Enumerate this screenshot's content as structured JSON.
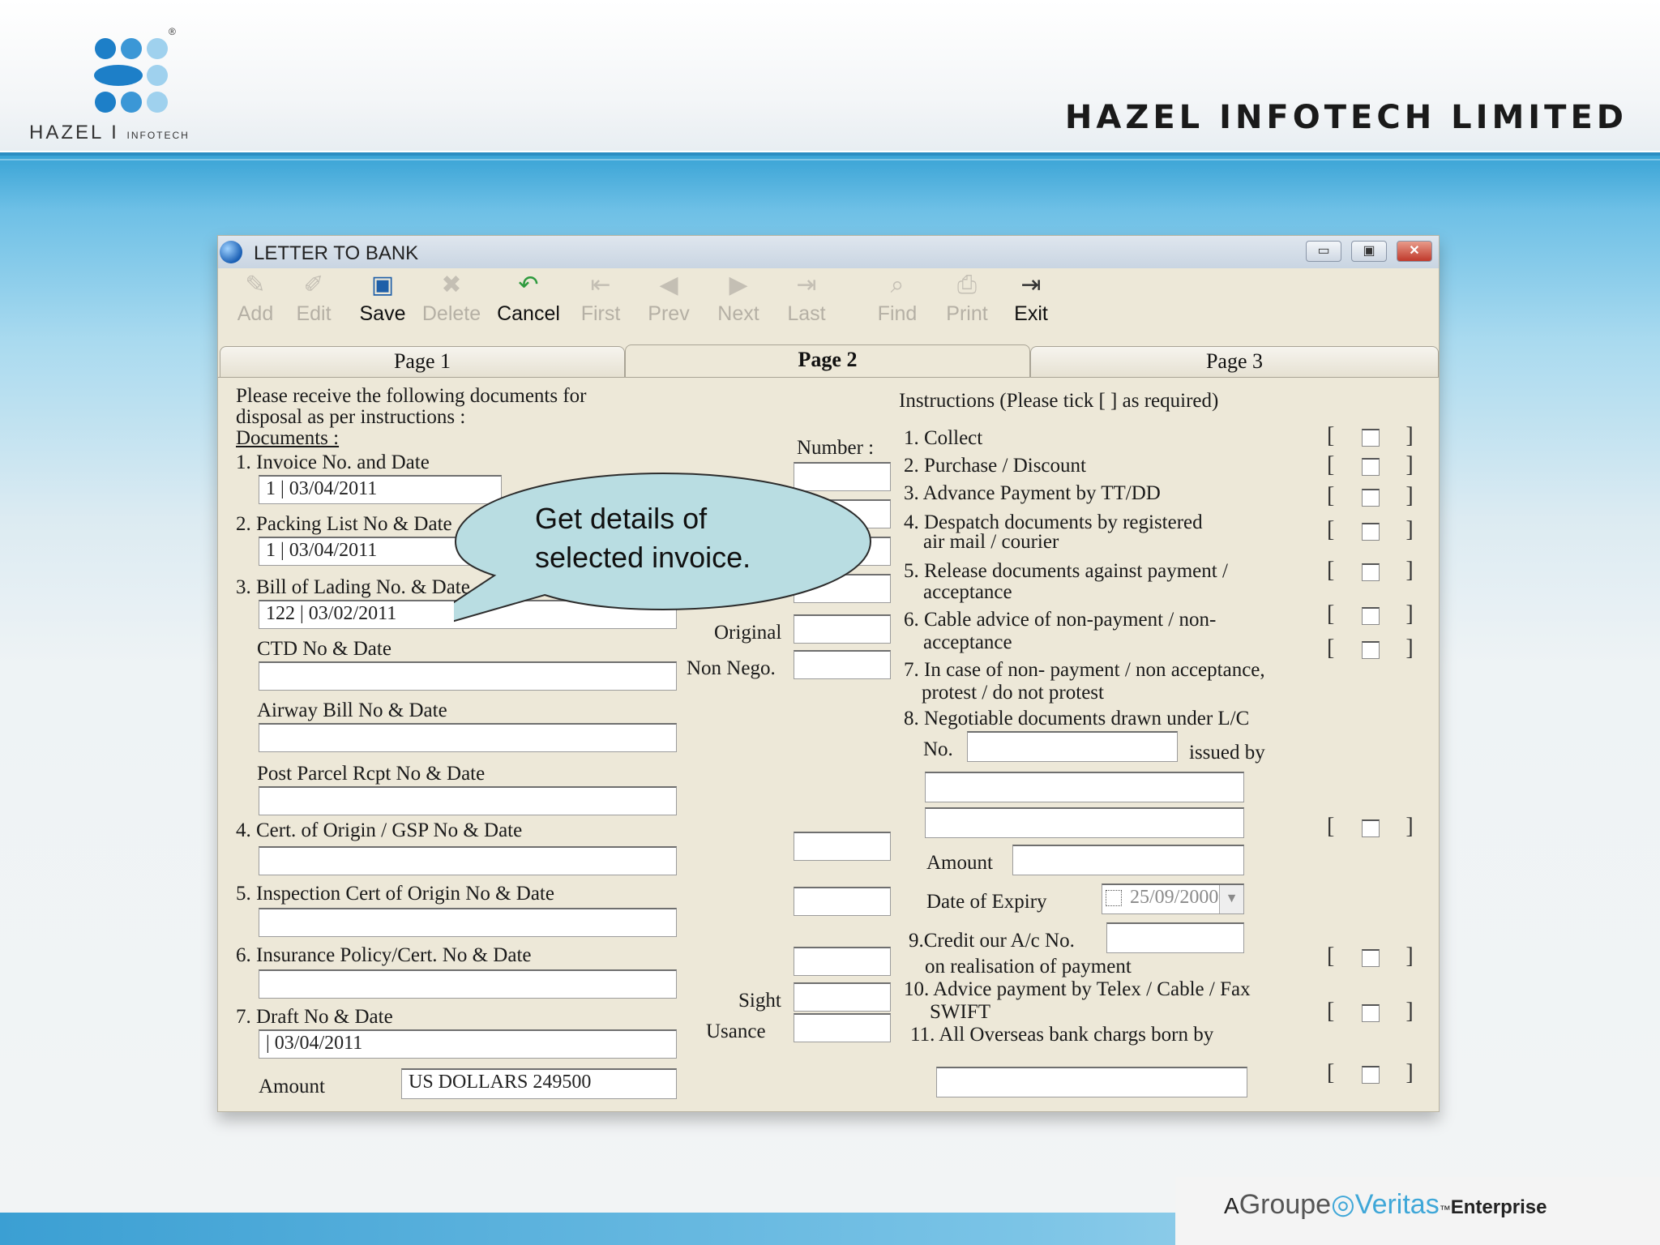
{
  "header": {
    "logo_text": "HAZEL",
    "logo_sub": "INFOTECH",
    "logo_sep": "I",
    "registered": "®",
    "company": "HAZEL INFOTECH LIMITED"
  },
  "footer": {
    "a": "A",
    "groupe": "Groupe",
    "veritas": "Veritas",
    "tm": "™",
    "enterprise": "Enterprise"
  },
  "window": {
    "title": "LETTER TO BANK",
    "controls": {
      "minimize": "▭",
      "maximize": "▣",
      "close": "✕"
    }
  },
  "toolbar": [
    {
      "label": "Add",
      "icon": "add-icon",
      "enabled": false
    },
    {
      "label": "Edit",
      "icon": "edit-icon",
      "enabled": false
    },
    {
      "label": "Save",
      "icon": "save-icon",
      "enabled": true
    },
    {
      "label": "Delete",
      "icon": "delete-icon",
      "enabled": false
    },
    {
      "label": "Cancel",
      "icon": "cancel-icon",
      "enabled": true
    },
    {
      "label": "First",
      "icon": "first-icon",
      "enabled": false
    },
    {
      "label": "Prev",
      "icon": "prev-icon",
      "enabled": false
    },
    {
      "label": "Next",
      "icon": "next-icon",
      "enabled": false
    },
    {
      "label": "Last",
      "icon": "last-icon",
      "enabled": false
    },
    {
      "label": "Find",
      "icon": "find-icon",
      "enabled": false
    },
    {
      "label": "Print",
      "icon": "print-icon",
      "enabled": false
    },
    {
      "label": "Exit",
      "icon": "exit-icon",
      "enabled": true
    }
  ],
  "tabs": [
    {
      "label": "Page 1",
      "active": false
    },
    {
      "label": "Page 2",
      "active": true
    },
    {
      "label": "Page 3",
      "active": false
    }
  ],
  "left": {
    "intro_line1": "Please receive the following documents for",
    "intro_line2": "disposal as per instructions  :",
    "documents_label": "Documents :",
    "number_label": "Number :",
    "invoice_label": "1. Invoice No. and Date",
    "invoice_value": "1  |  03/04/2011",
    "packing_label": "2. Packing List No & Date",
    "packing_value": "1  |  03/04/2011",
    "bol_label": "3. Bill of Lading No. & Date",
    "bol_value": "122 | 03/02/2011",
    "ctd_label": "CTD No & Date",
    "airway_label": "Airway Bill No & Date",
    "parcel_label": "Post Parcel Rcpt No & Date",
    "origin_label": "4. Cert. of Origin / GSP No & Date",
    "inspection_label": "5. Inspection Cert of Origin No & Date",
    "insurance_label": "6. Insurance Policy/Cert. No & Date",
    "draft_label": "7. Draft No & Date",
    "draft_value": " | 03/04/2011",
    "amount_label": "Amount",
    "amount_value": "US DOLLARS 249500",
    "original_label": "Original",
    "nonnego_label": "Non Nego.",
    "sight_label": "Sight",
    "usance_label": "Usance"
  },
  "right": {
    "heading": "Instructions  (Please tick [  ] as required)",
    "i1": "1. Collect",
    "i2": "2. Purchase / Discount",
    "i3": "3. Advance Payment by TT/DD",
    "i4a": "4. Despatch documents by registered",
    "i4b": "air mail / courier",
    "i5a": "5. Release documents against payment /",
    "i5b": "acceptance",
    "i6a": "6. Cable advice of non-payment / non-",
    "i6b": "acceptance",
    "i7a": "7. In case of non- payment / non acceptance,",
    "i7b": "protest / do not protest",
    "i8": "8. Negotiable documents drawn under L/C",
    "no_label": "No.",
    "issued_label": "issued by",
    "amount_label": "Amount",
    "expiry_label": "Date of Expiry",
    "expiry_value": "25/09/2000",
    "i9a": "9.Credit our A/c No.",
    "i9b": "on realisation of payment",
    "i10a": "10. Advice payment by Telex / Cable / Fax",
    "i10b": "SWIFT",
    "i11": "11. All Overseas bank chargs born by",
    "bracket_open": "[",
    "bracket_close": "]"
  },
  "callout": {
    "line1": "Get details of",
    "line2": "selected invoice."
  },
  "colors": {
    "accent_blue": "#3aa4d6",
    "window_bg": "#ede8d8",
    "callout_fill": "#b9dde2"
  }
}
